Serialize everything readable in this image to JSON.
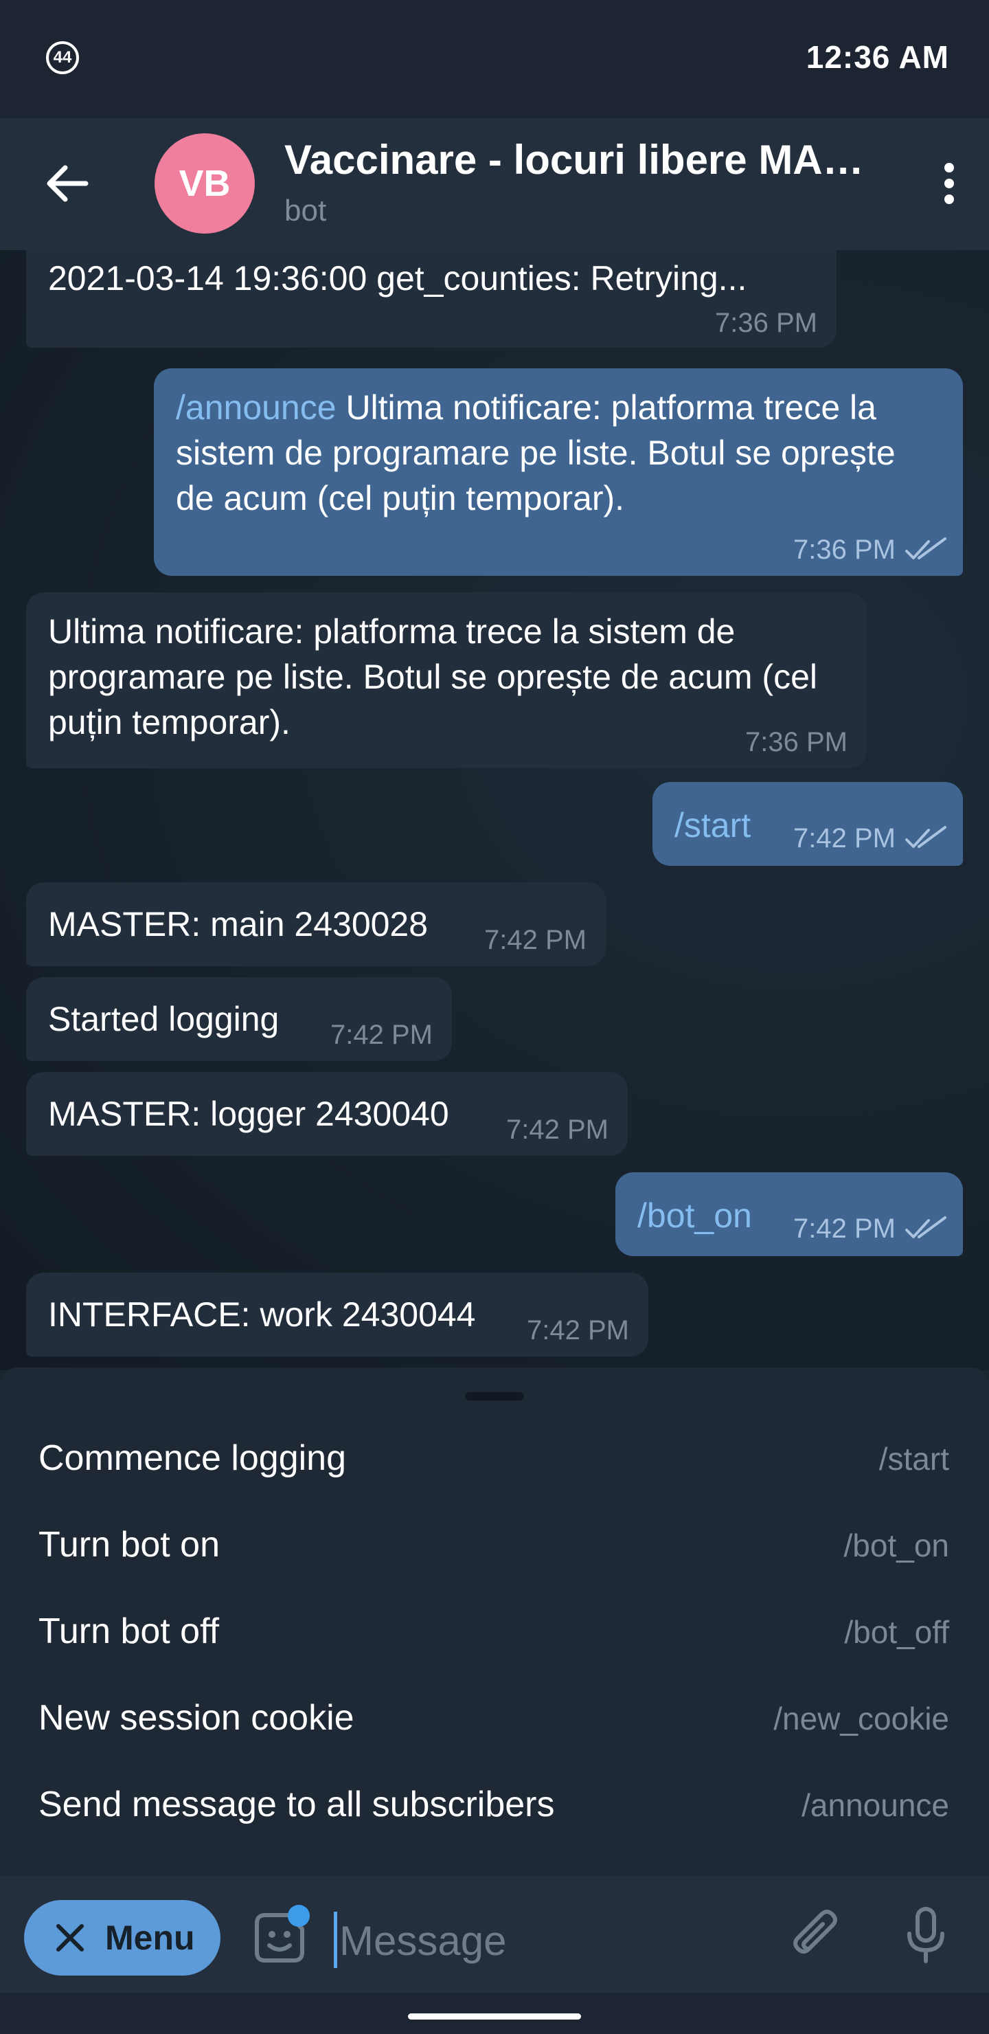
{
  "status": {
    "badge": "44",
    "time": "12:36 AM"
  },
  "header": {
    "avatar_initials": "VB",
    "title": "Vaccinare - locuri libere MASTER",
    "subtitle": "bot"
  },
  "messages": [
    {
      "text": "2021-03-14 19:36:00 get_counties: Retrying...",
      "time": "7:36 PM"
    },
    {
      "command": "/announce",
      "text": " Ultima notificare: platforma trece la sistem de programare pe liste. Botul se oprește de acum (cel puțin temporar).",
      "time": "7:36 PM"
    },
    {
      "text": "Ultima notificare: platforma trece la sistem de programare pe liste. Botul se oprește de acum (cel puțin temporar).",
      "time": "7:36 PM"
    },
    {
      "command": "/start",
      "time": "7:42 PM"
    },
    {
      "text": "MASTER: main 2430028",
      "time": "7:42 PM"
    },
    {
      "text": "Started logging",
      "time": "7:42 PM"
    },
    {
      "text": "MASTER: logger 2430040",
      "time": "7:42 PM"
    },
    {
      "command": "/bot_on",
      "time": "7:42 PM"
    },
    {
      "text": "INTERFACE: work 2430044",
      "time": "7:42 PM"
    }
  ],
  "commands": [
    {
      "description": "Commence logging",
      "command": "/start"
    },
    {
      "description": "Turn bot on",
      "command": "/bot_on"
    },
    {
      "description": "Turn bot off",
      "command": "/bot_off"
    },
    {
      "description": "New session cookie",
      "command": "/new_cookie"
    },
    {
      "description": "Send message to all subscribers",
      "command": "/announce"
    }
  ],
  "composer": {
    "menu_label": "Menu",
    "placeholder": "Message"
  },
  "icons": [
    "back-arrow-icon",
    "more-vertical-icon",
    "double-check-icon",
    "close-icon",
    "sticker-icon",
    "paperclip-icon",
    "microphone-icon"
  ],
  "colors": {
    "outgoing_bubble": "#3f6590",
    "incoming_bubble": "#222e3b",
    "avatar": "#f07f9e",
    "accent": "#5c9bd8"
  }
}
